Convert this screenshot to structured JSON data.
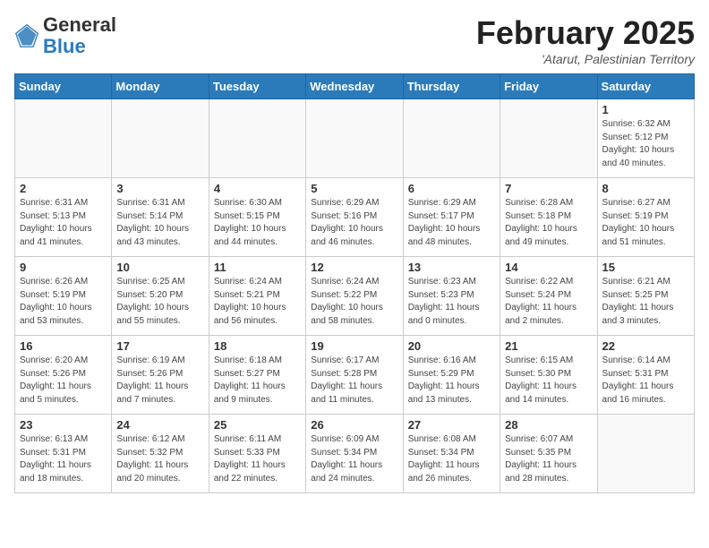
{
  "header": {
    "logo_general": "General",
    "logo_blue": "Blue",
    "month_title": "February 2025",
    "subtitle": "'Atarut, Palestinian Territory"
  },
  "weekdays": [
    "Sunday",
    "Monday",
    "Tuesday",
    "Wednesday",
    "Thursday",
    "Friday",
    "Saturday"
  ],
  "weeks": [
    [
      {
        "day": "",
        "info": ""
      },
      {
        "day": "",
        "info": ""
      },
      {
        "day": "",
        "info": ""
      },
      {
        "day": "",
        "info": ""
      },
      {
        "day": "",
        "info": ""
      },
      {
        "day": "",
        "info": ""
      },
      {
        "day": "1",
        "info": "Sunrise: 6:32 AM\nSunset: 5:12 PM\nDaylight: 10 hours\nand 40 minutes."
      }
    ],
    [
      {
        "day": "2",
        "info": "Sunrise: 6:31 AM\nSunset: 5:13 PM\nDaylight: 10 hours\nand 41 minutes."
      },
      {
        "day": "3",
        "info": "Sunrise: 6:31 AM\nSunset: 5:14 PM\nDaylight: 10 hours\nand 43 minutes."
      },
      {
        "day": "4",
        "info": "Sunrise: 6:30 AM\nSunset: 5:15 PM\nDaylight: 10 hours\nand 44 minutes."
      },
      {
        "day": "5",
        "info": "Sunrise: 6:29 AM\nSunset: 5:16 PM\nDaylight: 10 hours\nand 46 minutes."
      },
      {
        "day": "6",
        "info": "Sunrise: 6:29 AM\nSunset: 5:17 PM\nDaylight: 10 hours\nand 48 minutes."
      },
      {
        "day": "7",
        "info": "Sunrise: 6:28 AM\nSunset: 5:18 PM\nDaylight: 10 hours\nand 49 minutes."
      },
      {
        "day": "8",
        "info": "Sunrise: 6:27 AM\nSunset: 5:19 PM\nDaylight: 10 hours\nand 51 minutes."
      }
    ],
    [
      {
        "day": "9",
        "info": "Sunrise: 6:26 AM\nSunset: 5:19 PM\nDaylight: 10 hours\nand 53 minutes."
      },
      {
        "day": "10",
        "info": "Sunrise: 6:25 AM\nSunset: 5:20 PM\nDaylight: 10 hours\nand 55 minutes."
      },
      {
        "day": "11",
        "info": "Sunrise: 6:24 AM\nSunset: 5:21 PM\nDaylight: 10 hours\nand 56 minutes."
      },
      {
        "day": "12",
        "info": "Sunrise: 6:24 AM\nSunset: 5:22 PM\nDaylight: 10 hours\nand 58 minutes."
      },
      {
        "day": "13",
        "info": "Sunrise: 6:23 AM\nSunset: 5:23 PM\nDaylight: 11 hours\nand 0 minutes."
      },
      {
        "day": "14",
        "info": "Sunrise: 6:22 AM\nSunset: 5:24 PM\nDaylight: 11 hours\nand 2 minutes."
      },
      {
        "day": "15",
        "info": "Sunrise: 6:21 AM\nSunset: 5:25 PM\nDaylight: 11 hours\nand 3 minutes."
      }
    ],
    [
      {
        "day": "16",
        "info": "Sunrise: 6:20 AM\nSunset: 5:26 PM\nDaylight: 11 hours\nand 5 minutes."
      },
      {
        "day": "17",
        "info": "Sunrise: 6:19 AM\nSunset: 5:26 PM\nDaylight: 11 hours\nand 7 minutes."
      },
      {
        "day": "18",
        "info": "Sunrise: 6:18 AM\nSunset: 5:27 PM\nDaylight: 11 hours\nand 9 minutes."
      },
      {
        "day": "19",
        "info": "Sunrise: 6:17 AM\nSunset: 5:28 PM\nDaylight: 11 hours\nand 11 minutes."
      },
      {
        "day": "20",
        "info": "Sunrise: 6:16 AM\nSunset: 5:29 PM\nDaylight: 11 hours\nand 13 minutes."
      },
      {
        "day": "21",
        "info": "Sunrise: 6:15 AM\nSunset: 5:30 PM\nDaylight: 11 hours\nand 14 minutes."
      },
      {
        "day": "22",
        "info": "Sunrise: 6:14 AM\nSunset: 5:31 PM\nDaylight: 11 hours\nand 16 minutes."
      }
    ],
    [
      {
        "day": "23",
        "info": "Sunrise: 6:13 AM\nSunset: 5:31 PM\nDaylight: 11 hours\nand 18 minutes."
      },
      {
        "day": "24",
        "info": "Sunrise: 6:12 AM\nSunset: 5:32 PM\nDaylight: 11 hours\nand 20 minutes."
      },
      {
        "day": "25",
        "info": "Sunrise: 6:11 AM\nSunset: 5:33 PM\nDaylight: 11 hours\nand 22 minutes."
      },
      {
        "day": "26",
        "info": "Sunrise: 6:09 AM\nSunset: 5:34 PM\nDaylight: 11 hours\nand 24 minutes."
      },
      {
        "day": "27",
        "info": "Sunrise: 6:08 AM\nSunset: 5:34 PM\nDaylight: 11 hours\nand 26 minutes."
      },
      {
        "day": "28",
        "info": "Sunrise: 6:07 AM\nSunset: 5:35 PM\nDaylight: 11 hours\nand 28 minutes."
      },
      {
        "day": "",
        "info": ""
      }
    ]
  ]
}
